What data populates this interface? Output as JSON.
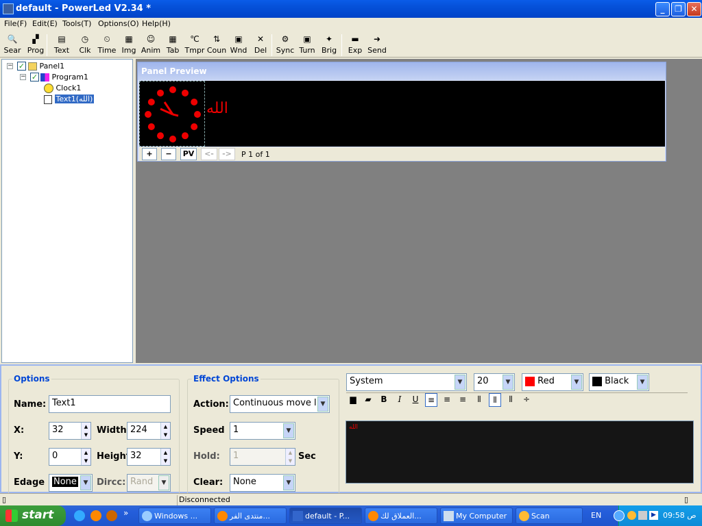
{
  "window": {
    "title": "default - PowerLed V2.34 *"
  },
  "menu": [
    "File(F)",
    "Edit(E)",
    "Tools(T)",
    "Options(O)",
    "Help(H)"
  ],
  "toolbar": [
    {
      "label": "Sear",
      "icon": "magnifier-icon",
      "glyph": "🔍"
    },
    {
      "label": "Prog",
      "icon": "program-icon",
      "glyph": "▞"
    },
    {
      "label": "Text",
      "icon": "text-doc-icon",
      "glyph": "▤"
    },
    {
      "label": "Clk",
      "icon": "clock-icon",
      "glyph": "◷"
    },
    {
      "label": "Time",
      "icon": "time-icon",
      "glyph": "⏲"
    },
    {
      "label": "Img",
      "icon": "image-icon",
      "glyph": "▦"
    },
    {
      "label": "Anim",
      "icon": "smiley-icon",
      "glyph": "☺"
    },
    {
      "label": "Tab",
      "icon": "table-icon",
      "glyph": "▦"
    },
    {
      "label": "Tmpr",
      "icon": "temperature-icon",
      "glyph": "℃"
    },
    {
      "label": "Coun",
      "icon": "counter-icon",
      "glyph": "⇅"
    },
    {
      "label": "Wnd",
      "icon": "window-icon",
      "glyph": "▣"
    },
    {
      "label": "Del",
      "icon": "delete-icon",
      "glyph": "✕"
    },
    {
      "label": "Sync",
      "icon": "sync-icon",
      "glyph": "⚙"
    },
    {
      "label": "Turn",
      "icon": "turn-icon",
      "glyph": "▣"
    },
    {
      "label": "Brig",
      "icon": "bulb-icon",
      "glyph": "✦"
    },
    {
      "label": "Exp",
      "icon": "export-icon",
      "glyph": "▬"
    },
    {
      "label": "Send",
      "icon": "send-icon",
      "glyph": "➜"
    }
  ],
  "tree": {
    "panel": "Panel1",
    "program": "Program1",
    "clock": "Clock1",
    "text": "Text1(الله)"
  },
  "preview": {
    "title": "Panel Preview",
    "led_text": "الله",
    "page_label": "P 1 of 1",
    "plus": "+",
    "minus": "−",
    "pv": "PV",
    "prev": "<-",
    "next": "->"
  },
  "options": {
    "title": "Options",
    "name_label": "Name:",
    "name_value": "Text1",
    "x_label": "X:",
    "x_value": "32",
    "width_label": "Width:",
    "width_value": "224",
    "y_label": "Y:",
    "y_value": "0",
    "height_label": "Height",
    "height_value": "32",
    "edge_label": "Edage",
    "edge_value": "None",
    "dirc_label": "Dircc:",
    "dirc_value": "Rand"
  },
  "effects": {
    "title": "Effect Options",
    "action_label": "Action:",
    "action_value": "Continuous move l",
    "speed_label": "Speed",
    "speed_value": "1",
    "hold_label": "Hold:",
    "hold_value": "1",
    "hold_unit": "Sec",
    "clear_label": "Clear:",
    "clear_value": "None"
  },
  "font": {
    "family": "System",
    "size": "20",
    "fg_label": "Red",
    "fg_color": "#ff0000",
    "bg_label": "Black",
    "bg_color": "#000000"
  },
  "format_buttons": [
    "save-icon",
    "open-folder-icon",
    "bold-icon",
    "italic-icon",
    "underline-icon",
    "align-left-icon",
    "align-center-icon",
    "align-right-icon",
    "valign-top-icon",
    "valign-middle-icon",
    "valign-bottom-icon",
    "spacing-icon"
  ],
  "editor_text": "الله",
  "status": {
    "connection": "Disconnected"
  },
  "taskbar": {
    "start": "start",
    "tasks": [
      "Windows ...",
      "منتدى الفر...",
      "default - P...",
      "العملاق لك...",
      "My Computer",
      "Scan"
    ],
    "lang": "EN",
    "clock": "09:58 ص"
  }
}
